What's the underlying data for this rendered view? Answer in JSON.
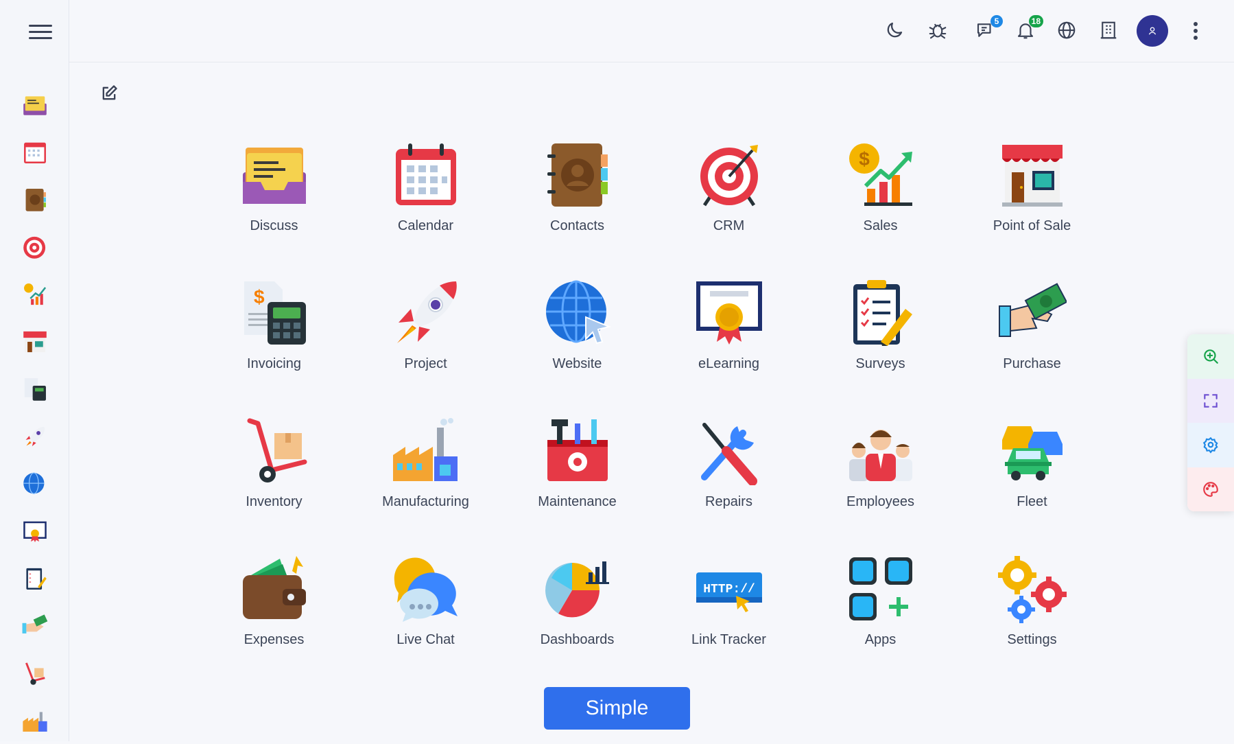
{
  "topbar": {
    "messages_badge": "5",
    "notifications_badge": "18",
    "messages_badge_color": "#1e88e5",
    "notifications_badge_color": "#16a34a"
  },
  "apps": [
    {
      "label": "Discuss",
      "icon": "discuss-icon"
    },
    {
      "label": "Calendar",
      "icon": "calendar-icon"
    },
    {
      "label": "Contacts",
      "icon": "contacts-icon"
    },
    {
      "label": "CRM",
      "icon": "crm-target-icon"
    },
    {
      "label": "Sales",
      "icon": "sales-chart-icon"
    },
    {
      "label": "Point of Sale",
      "icon": "store-icon"
    },
    {
      "label": "Invoicing",
      "icon": "invoice-calculator-icon"
    },
    {
      "label": "Project",
      "icon": "rocket-icon"
    },
    {
      "label": "Website",
      "icon": "globe-cursor-icon"
    },
    {
      "label": "eLearning",
      "icon": "certificate-icon"
    },
    {
      "label": "Surveys",
      "icon": "clipboard-checklist-icon"
    },
    {
      "label": "Purchase",
      "icon": "hand-money-icon"
    },
    {
      "label": "Inventory",
      "icon": "hand-truck-icon"
    },
    {
      "label": "Manufacturing",
      "icon": "factory-icon"
    },
    {
      "label": "Maintenance",
      "icon": "toolbox-icon"
    },
    {
      "label": "Repairs",
      "icon": "wrench-screwdriver-icon"
    },
    {
      "label": "Employees",
      "icon": "people-icon"
    },
    {
      "label": "Fleet",
      "icon": "cars-icon"
    },
    {
      "label": "Expenses",
      "icon": "wallet-icon"
    },
    {
      "label": "Live Chat",
      "icon": "chat-bubbles-icon"
    },
    {
      "label": "Dashboards",
      "icon": "pie-chart-icon"
    },
    {
      "label": "Link Tracker",
      "icon": "http-link-icon"
    },
    {
      "label": "Apps",
      "icon": "apps-grid-icon"
    },
    {
      "label": "Settings",
      "icon": "gears-icon"
    }
  ],
  "link_tracker_text": "HTTP://",
  "sales_symbol": "$",
  "invoice_symbol": "$",
  "simple_button": "Simple",
  "colors": {
    "accent": "#2f6fec",
    "avatar": "#2f3393"
  }
}
